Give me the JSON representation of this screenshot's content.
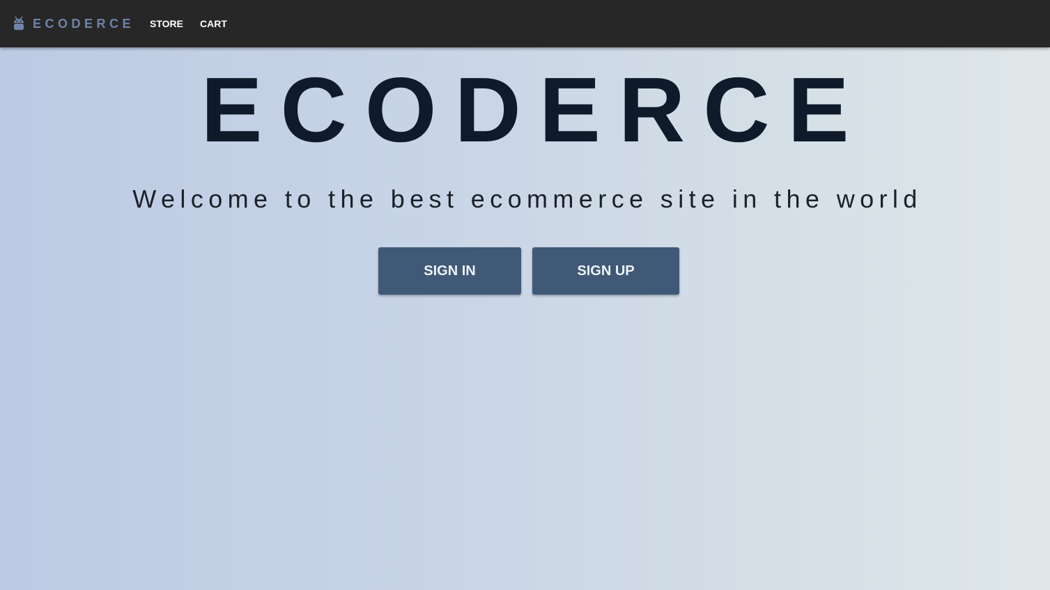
{
  "navbar": {
    "brand_icon": "android-icon",
    "brand_label": "ECODERCE",
    "links": [
      {
        "label": "STORE"
      },
      {
        "label": "CART"
      }
    ]
  },
  "hero": {
    "title": "ECODERCE",
    "subtitle": "Welcome to the best ecommerce site in the world"
  },
  "actions": {
    "sign_in_label": "SIGN IN",
    "sign_up_label": "SIGN UP"
  },
  "colors": {
    "navbar_bg": "#272727",
    "brand_text": "#6f84a8",
    "title_text": "#0f1b2b",
    "button_bg": "#405977"
  }
}
